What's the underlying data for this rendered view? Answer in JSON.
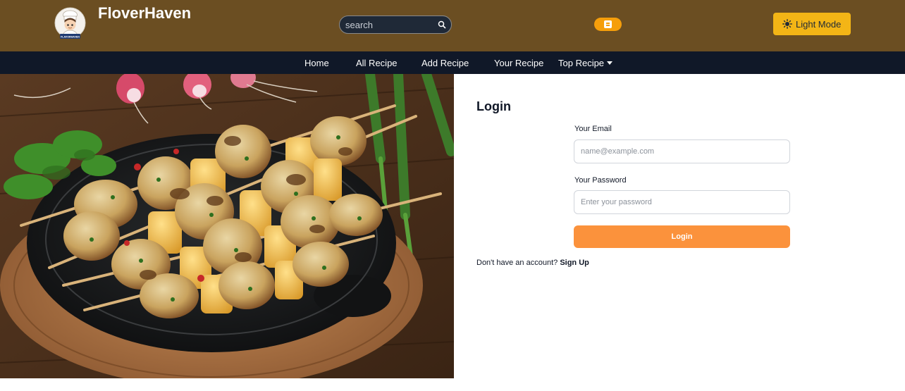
{
  "header": {
    "brand": "FloverHaven",
    "logo_text": "FLAVORHAVEN",
    "search_placeholder": "search",
    "search_icon": "search-icon",
    "blog_icon": "blogger-icon",
    "mode_label": "Light Mode",
    "mode_icon": "sun-icon",
    "colors": {
      "header_bg": "#6b4e22",
      "nav_bg": "#101828",
      "accent": "#fb923c",
      "mode_btn": "#f3b516"
    }
  },
  "nav": {
    "items": [
      {
        "label": "Home"
      },
      {
        "label": "All Recipe"
      },
      {
        "label": "Add Recipe"
      },
      {
        "label": "Your Recipe"
      },
      {
        "label": "Top Recipe",
        "has_dropdown": true
      }
    ]
  },
  "hero": {
    "subject": "chicken-skewers-image"
  },
  "login": {
    "title": "Login",
    "email_label": "Your Email",
    "email_placeholder": "name@example.com",
    "password_label": "Your Password",
    "password_placeholder": "Enter your password",
    "button_label": "Login",
    "no_account_text": "Don't have an account?",
    "signup_label": "Sign Up"
  }
}
